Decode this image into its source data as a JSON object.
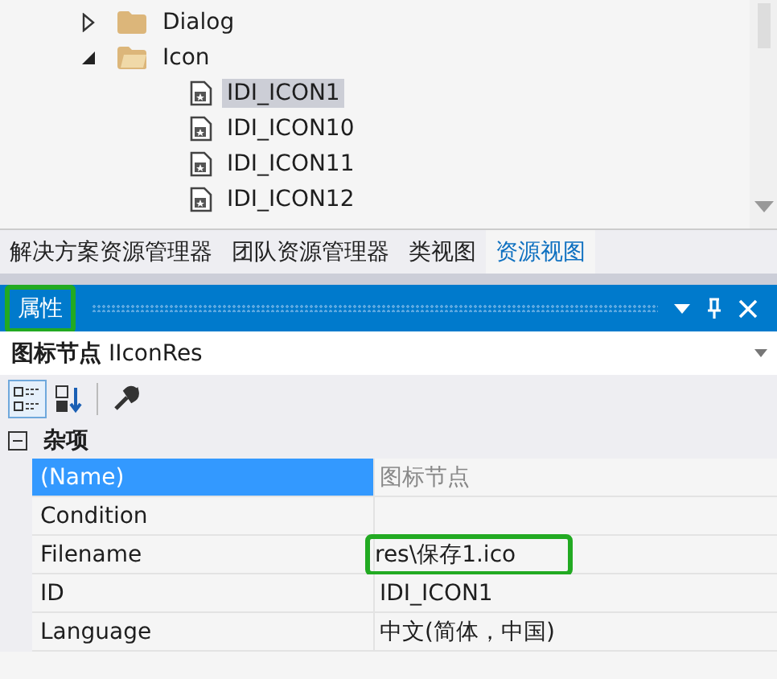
{
  "tree": {
    "items": [
      {
        "label": "Dialog",
        "kind": "folder",
        "expanded": false,
        "selected": false
      },
      {
        "label": "Icon",
        "kind": "folder",
        "expanded": true,
        "selected": false,
        "children": [
          {
            "label": "IDI_ICON1",
            "kind": "icon",
            "selected": true
          },
          {
            "label": "IDI_ICON10",
            "kind": "icon",
            "selected": false
          },
          {
            "label": "IDI_ICON11",
            "kind": "icon",
            "selected": false
          },
          {
            "label": "IDI_ICON12",
            "kind": "icon",
            "selected": false
          }
        ]
      }
    ]
  },
  "tabs": [
    {
      "label": "解决方案资源管理器",
      "selected": false
    },
    {
      "label": "团队资源管理器",
      "selected": false
    },
    {
      "label": "类视图",
      "selected": false
    },
    {
      "label": "资源视图",
      "selected": true
    }
  ],
  "properties_panel": {
    "title": "属性",
    "title_highlighted": true,
    "object": "**图标节点** IIconRes",
    "toolbar": [
      {
        "kind": "categorized",
        "selected": true
      },
      {
        "kind": "alphabetical",
        "selected": false
      },
      {
        "kind": "separator"
      },
      {
        "kind": "property-pages",
        "selected": false
      }
    ],
    "category": {
      "label": "杂项",
      "expanded": true
    },
    "rows": [
      {
        "name": "(Name)",
        "value": "图标节点",
        "selected": true,
        "readonly": true,
        "highlighted": false
      },
      {
        "name": "Condition",
        "value": "",
        "selected": false,
        "readonly": false,
        "highlighted": false
      },
      {
        "name": "Filename",
        "value": "res\\保存1.ico",
        "selected": false,
        "readonly": false,
        "highlighted": true
      },
      {
        "name": "ID",
        "value": "IDI_ICON1",
        "selected": false,
        "readonly": false,
        "highlighted": false
      },
      {
        "name": "Language",
        "value": "中文(简体，中国)",
        "selected": false,
        "readonly": false,
        "highlighted": false
      }
    ]
  }
}
